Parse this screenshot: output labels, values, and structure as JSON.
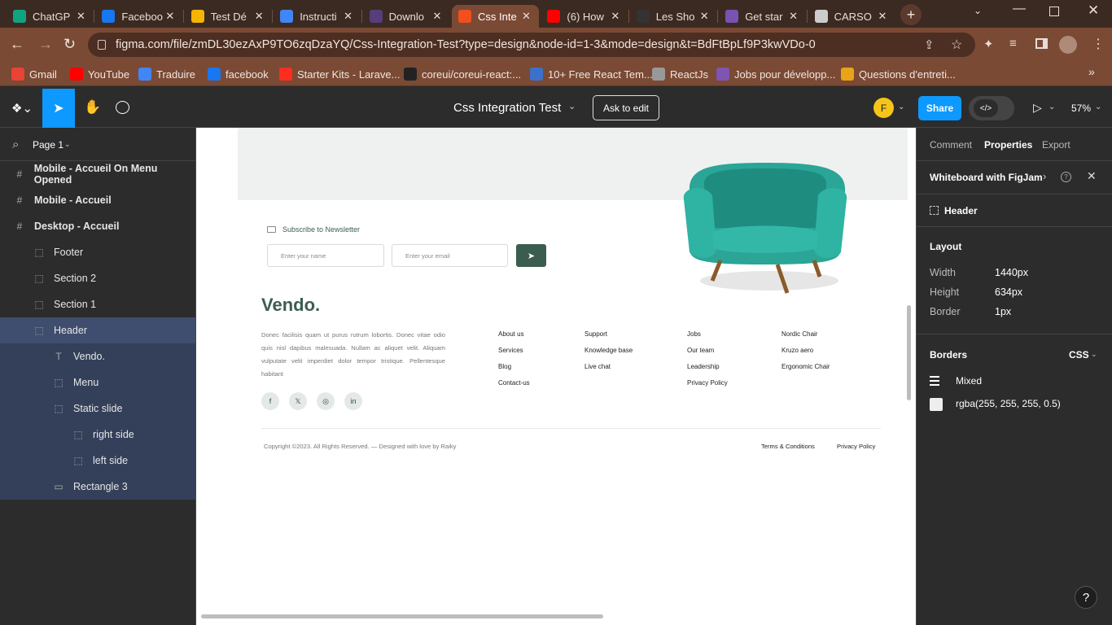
{
  "browser": {
    "tabs": [
      {
        "label": "ChatGP",
        "icon": "chatgpt-icon",
        "color": "#10a37f"
      },
      {
        "label": "Faceboo",
        "icon": "facebook-icon",
        "color": "#1877f2"
      },
      {
        "label": "Test Dé",
        "icon": "google-drive-icon",
        "color": "#f4b400"
      },
      {
        "label": "Instructi",
        "icon": "google-docs-icon",
        "color": "#4285f4"
      },
      {
        "label": "Downlo",
        "icon": "bootstrap-icon",
        "color": "#563d7c"
      },
      {
        "label": "Css Inte",
        "icon": "figma-icon",
        "color": "#f24e1e",
        "active": true
      },
      {
        "label": "(6) How",
        "icon": "youtube-icon",
        "color": "#ff0000"
      },
      {
        "label": "Les Sho",
        "icon": "w-icon",
        "color": "#333333"
      },
      {
        "label": "Get star",
        "icon": "bootstrap-icon",
        "color": "#7952b3"
      },
      {
        "label": "CARSO",
        "icon": "carso-icon",
        "color": "#cccccc"
      }
    ],
    "url": "figma.com/file/zmDL30ezAxP9TO6zqDzaYQ/Css-Integration-Test?type=design&node-id=1-3&mode=design&t=BdFtBpLf9P3kwVDo-0",
    "bookmarks": [
      {
        "label": "Gmail",
        "icon": "gmail-icon",
        "color": "#ea4335"
      },
      {
        "label": "YouTube",
        "icon": "youtube-icon",
        "color": "#ff0000"
      },
      {
        "label": "Traduire",
        "icon": "translate-icon",
        "color": "#4285f4"
      },
      {
        "label": "facebook",
        "icon": "facebook-icon",
        "color": "#1877f2"
      },
      {
        "label": "Starter Kits - Larave...",
        "icon": "laravel-icon",
        "color": "#ff2d20"
      },
      {
        "label": "coreui/coreui-react:...",
        "icon": "github-icon",
        "color": "#222222"
      },
      {
        "label": "10+ Free React Tem...",
        "icon": "te-icon",
        "color": "#3b71ca"
      },
      {
        "label": "ReactJs",
        "icon": "reactjs-icon",
        "color": "#999999"
      },
      {
        "label": "Jobs pour développ...",
        "icon": "woo-icon",
        "color": "#7f54b3"
      },
      {
        "label": "Questions d'entreti...",
        "icon": "questions-icon",
        "color": "#e8a317"
      }
    ]
  },
  "figma": {
    "file_title": "Css Integration Test",
    "ask_to_edit": "Ask to edit",
    "avatar_letter": "F",
    "share_label": "Share",
    "zoom": "57%",
    "page_label": "Page 1",
    "layers": [
      {
        "label": "Mobile - Accueil On Menu Opened",
        "icon": "frame-icon",
        "bold": true,
        "indent": 0
      },
      {
        "label": "Mobile - Accueil",
        "icon": "frame-icon",
        "bold": true,
        "indent": 0
      },
      {
        "label": "Desktop - Accueil",
        "icon": "frame-icon",
        "bold": true,
        "indent": 0
      },
      {
        "label": "Footer",
        "icon": "group-icon",
        "indent": 1
      },
      {
        "label": "Section 2",
        "icon": "group-icon",
        "indent": 1
      },
      {
        "label": "Section 1",
        "icon": "group-icon",
        "indent": 1
      },
      {
        "label": "Header",
        "icon": "group-icon",
        "indent": 1,
        "selected": true
      },
      {
        "label": "Vendo.",
        "icon": "text-icon",
        "indent": 2,
        "sub": true
      },
      {
        "label": "Menu",
        "icon": "group-icon",
        "indent": 2,
        "sub": true
      },
      {
        "label": "Static slide",
        "icon": "group-icon",
        "indent": 2,
        "sub": true
      },
      {
        "label": "right side",
        "icon": "group-icon",
        "indent": 3,
        "sub": true
      },
      {
        "label": "left side",
        "icon": "group-icon",
        "indent": 3,
        "sub": true
      },
      {
        "label": "Rectangle 3",
        "icon": "rectangle-icon",
        "indent": 2,
        "sub": true
      }
    ],
    "right_tabs": [
      "Comment",
      "Properties",
      "Export"
    ],
    "whiteboard": "Whiteboard with FigJam",
    "selected_layer": "Header",
    "layout_title": "Layout",
    "layout": [
      {
        "label": "Width",
        "value": "1440px"
      },
      {
        "label": "Height",
        "value": "634px"
      },
      {
        "label": "Border",
        "value": "1px"
      }
    ],
    "borders_title": "Borders",
    "borders_format": "CSS",
    "border_style": "Mixed",
    "border_color": "rgba(255, 255, 255, 0.5)",
    "help": "?"
  },
  "design": {
    "newsletter_label": "Subscribe to Newsletter",
    "name_placeholder": "Enter your name",
    "email_placeholder": "Enter your email",
    "brand": "Vendo.",
    "description": "Donec facilisis quam ut purus rutrum lobortis. Donec vitae odio quis nisl dapibus malesuada. Nullam ac aliquet velit. Aliquam vulputate velit imperdiet dolor tempor tristique. Pellentesque habitant",
    "columns": [
      [
        "About us",
        "Services",
        "Blog",
        "Contact-us"
      ],
      [
        "Support",
        "Knowledge base",
        "Live chat"
      ],
      [
        "Jobs",
        "Our team",
        "Leadership",
        "Privacy Policy"
      ],
      [
        "Nordic Chair",
        "Kruzo aero",
        "Ergonomic Chair"
      ]
    ],
    "socials": [
      "facebook-icon",
      "x-icon",
      "instagram-icon",
      "linkedin-icon"
    ],
    "copyright": "Copyright ©2023. All Rights Reserved. — Designed with love by Raiky",
    "terms": "Terms & Conditions",
    "privacy": "Privacy Policy",
    "accent_color": "#3b5d50"
  }
}
